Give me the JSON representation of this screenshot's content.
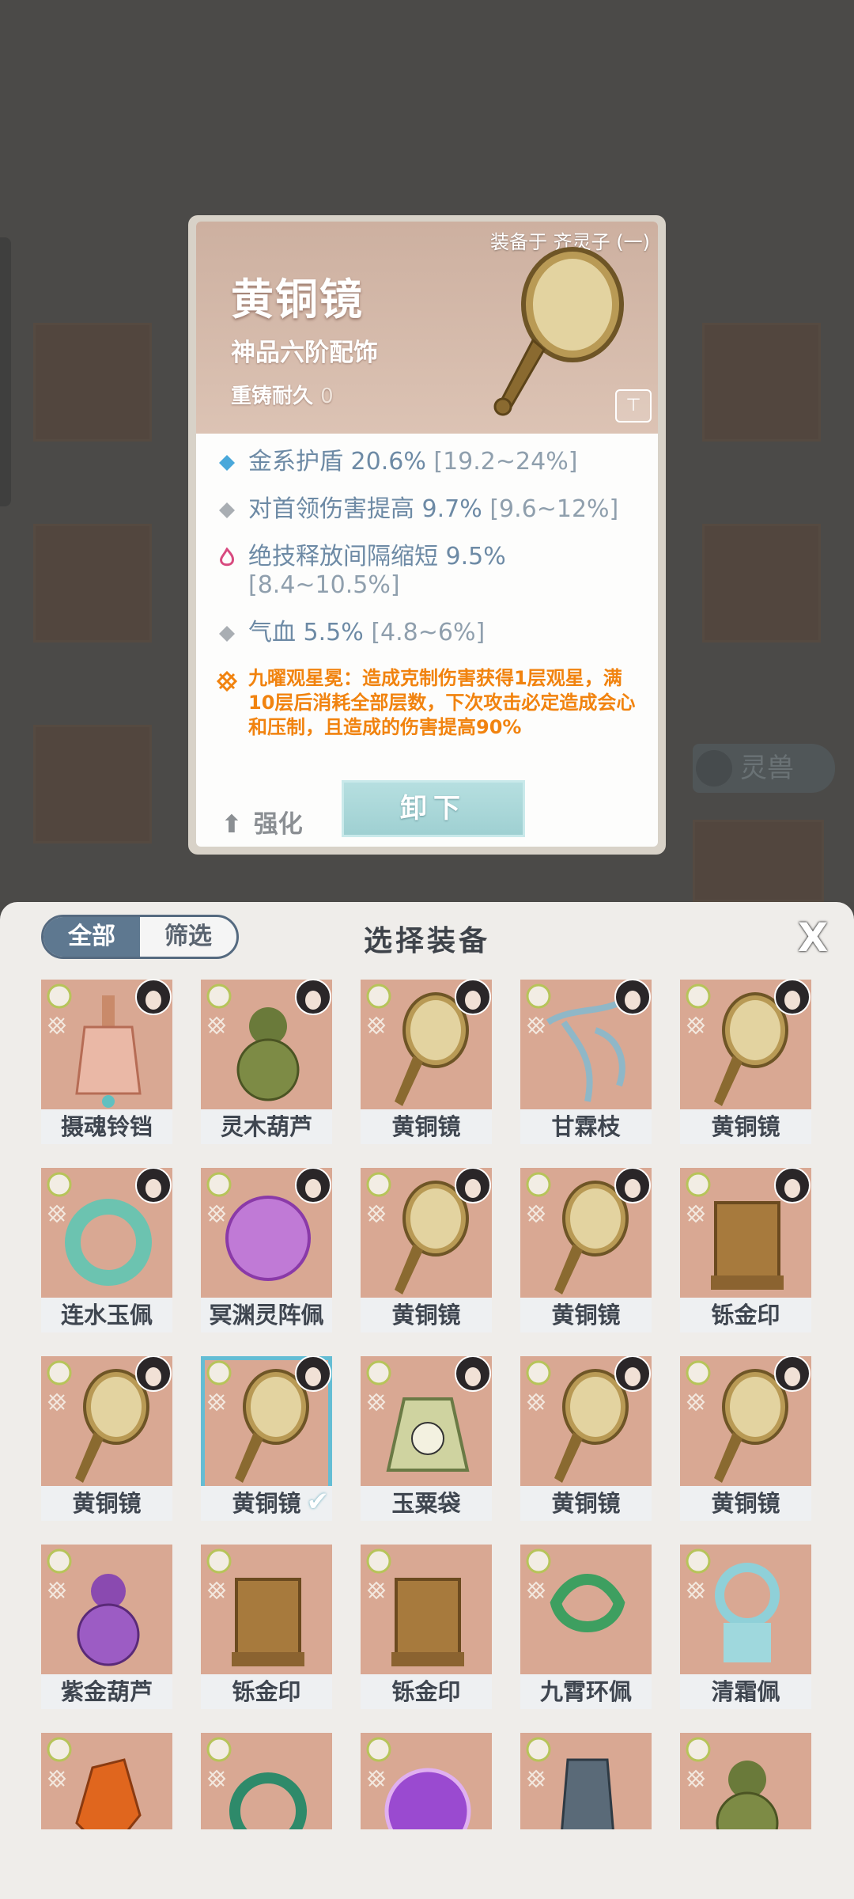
{
  "detail": {
    "equipped_on": "装备于 齐灵子 (一)",
    "name": "黄铜镜",
    "grade": "神品六阶配饰",
    "recast_label": "重铸耐久",
    "recast_value": "0",
    "stats": [
      {
        "text": "金系护盾 20.6%",
        "range": "[19.2~24%]",
        "icon": "diamond-blue-icon",
        "color": "#6d8aa5"
      },
      {
        "text": "对首领伤害提高 9.7%",
        "range": "[9.6~12%]",
        "icon": "diamond-gray-icon",
        "color": "#6d8aa5"
      },
      {
        "text": "绝技释放间隔缩短 9.5%",
        "range": "[8.4~10.5%]",
        "icon": "flame-pink-icon",
        "color": "#6d8aa5"
      },
      {
        "text": "气血 5.5%",
        "range": "[4.8~6%]",
        "icon": "diamond-gray-icon",
        "color": "#6d8aa5"
      }
    ],
    "special": "九曜观星冕：造成克制伤害获得1层观星，满10层后消耗全部层数，下次攻击必定造成会心和压制，且造成的伤害提高90%",
    "enhance_label": "强化",
    "unequip_label": "卸下"
  },
  "background": {
    "pet_label": "灵兽"
  },
  "panel": {
    "tabs": [
      {
        "label": "全部",
        "active": true
      },
      {
        "label": "筛选",
        "active": false
      }
    ],
    "title": "选择装备",
    "close_label": "X"
  },
  "items": [
    {
      "name": "摄魂铃铛",
      "art": "bell"
    },
    {
      "name": "灵木葫芦",
      "art": "gourd-green"
    },
    {
      "name": "黄铜镜",
      "art": "mirror"
    },
    {
      "name": "甘霖枝",
      "art": "branch"
    },
    {
      "name": "黄铜镜",
      "art": "mirror"
    },
    {
      "name": "连水玉佩",
      "art": "jade-ring"
    },
    {
      "name": "冥渊灵阵佩",
      "art": "purple-orb"
    },
    {
      "name": "黄铜镜",
      "art": "mirror"
    },
    {
      "name": "黄铜镜",
      "art": "mirror"
    },
    {
      "name": "铄金印",
      "art": "seal"
    },
    {
      "name": "黄铜镜",
      "art": "mirror"
    },
    {
      "name": "黄铜镜",
      "art": "mirror",
      "selected": true
    },
    {
      "name": "玉粟袋",
      "art": "bag"
    },
    {
      "name": "黄铜镜",
      "art": "mirror"
    },
    {
      "name": "黄铜镜",
      "art": "mirror"
    },
    {
      "name": "紫金葫芦",
      "art": "gourd-purple"
    },
    {
      "name": "铄金印",
      "art": "seal"
    },
    {
      "name": "铄金印",
      "art": "seal"
    },
    {
      "name": "九霄环佩",
      "art": "green-pendant"
    },
    {
      "name": "清霜佩",
      "art": "ice-pendant"
    },
    {
      "name": "",
      "art": "crystal"
    },
    {
      "name": "",
      "art": "jade-coin"
    },
    {
      "name": "",
      "art": "purple-orb2"
    },
    {
      "name": "",
      "art": "stone-tablet"
    },
    {
      "name": "",
      "art": "gourd-green"
    }
  ],
  "colors": {
    "accent": "#5e7890",
    "stat_blue": "#6d8aa5",
    "special_orange": "#f1830f",
    "tile_bg": "#d9a893",
    "select_outline": "#64bdd4"
  }
}
